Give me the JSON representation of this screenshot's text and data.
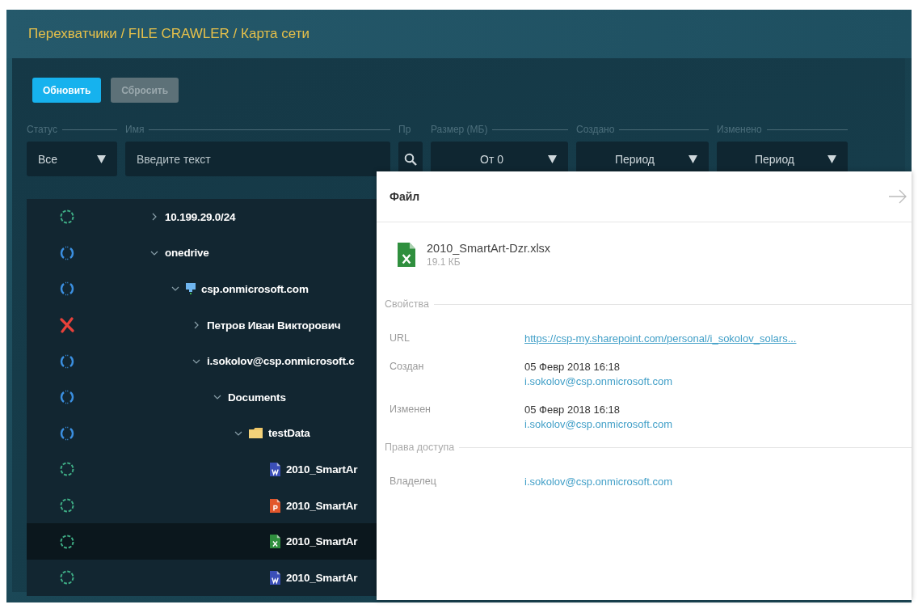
{
  "breadcrumb": "Перехватчики / FILE CRAWLER / Карта сети",
  "buttons": [
    {
      "label": "Обновить",
      "disabled": false
    },
    {
      "label": "Сбросить",
      "disabled": true
    }
  ],
  "filters": [
    {
      "kind": "select",
      "label": "Статус",
      "value": "Все"
    },
    {
      "kind": "text",
      "label": "Имя",
      "placeholder": "Введите текст"
    },
    {
      "kind": "search",
      "label": "Пр"
    },
    {
      "kind": "select",
      "label": "Размер (МБ)",
      "value": "От 0"
    },
    {
      "kind": "select",
      "label": "Создано",
      "value": "Период"
    },
    {
      "kind": "select",
      "label": "Изменено",
      "value": "Период"
    }
  ],
  "tree": [
    {
      "name": "10.199.29.0/24",
      "status": {
        "kind": "ok"
      },
      "expanded": false,
      "selected": false
    },
    {
      "name": "onedrive",
      "status": {
        "kind": "sync"
      },
      "expanded": true,
      "selected": false,
      "children": [
        {
          "name": "csp.onmicrosoft.com",
          "kind": "host",
          "status": {
            "kind": "sync"
          },
          "expanded": true,
          "selected": false,
          "children": [
            {
              "name": "Петров Иван Викторович",
              "status": {
                "kind": "error"
              },
              "expanded": false,
              "selected": false
            },
            {
              "name": "i.sokolov@csp.onmicrosoft.c",
              "status": {
                "kind": "sync"
              },
              "expanded": true,
              "selected": false,
              "children": [
                {
                  "name": "Documents",
                  "status": {
                    "kind": "sync"
                  },
                  "expanded": true,
                  "selected": false,
                  "children": [
                    {
                      "name": "testData",
                      "kind": "folder",
                      "status": {
                        "kind": "sync"
                      },
                      "expanded": true,
                      "selected": false,
                      "children": [
                        {
                          "name": "2010_SmartAr",
                          "kind": "word",
                          "status": {
                            "kind": "ok"
                          },
                          "selected": false
                        },
                        {
                          "name": "2010_SmartAr",
                          "kind": "powerpoint",
                          "status": {
                            "kind": "ok"
                          },
                          "selected": false
                        },
                        {
                          "name": "2010_SmartAr",
                          "kind": "excel",
                          "status": {
                            "kind": "ok"
                          },
                          "selected": true
                        },
                        {
                          "name": "2010_SmartAr",
                          "kind": "word",
                          "status": {
                            "kind": "ok"
                          },
                          "selected": false
                        }
                      ]
                    }
                  ]
                }
              ]
            }
          ]
        }
      ]
    }
  ],
  "panel": {
    "title": "Файл",
    "file": {
      "name": "2010_SmartArt-Dzr.xlsx",
      "size": "19.1 КБ",
      "kind": "excel"
    },
    "sections": [
      {
        "title": "Свойства",
        "rows": [
          {
            "label": "URL",
            "lines": [
              {
                "text": "https://csp-my.sharepoint.com/personal/i_sokolov_solars...",
                "kind": "url"
              }
            ]
          },
          {
            "label": "Создан",
            "lines": [
              {
                "text": "05 Февр 2018 16:18",
                "kind": "plain"
              },
              {
                "text": "i.sokolov@csp.onmicrosoft.com",
                "kind": "user"
              }
            ]
          },
          {
            "label": "Изменен",
            "lines": [
              {
                "text": "05 Февр 2018 16:18",
                "kind": "plain"
              },
              {
                "text": "i.sokolov@csp.onmicrosoft.com",
                "kind": "user"
              }
            ]
          }
        ]
      },
      {
        "title": "Права доступа",
        "rows": [
          {
            "label": "Владелец",
            "lines": [
              {
                "text": "i.sokolov@csp.onmicrosoft.com",
                "kind": "user"
              }
            ]
          }
        ]
      }
    ]
  }
}
